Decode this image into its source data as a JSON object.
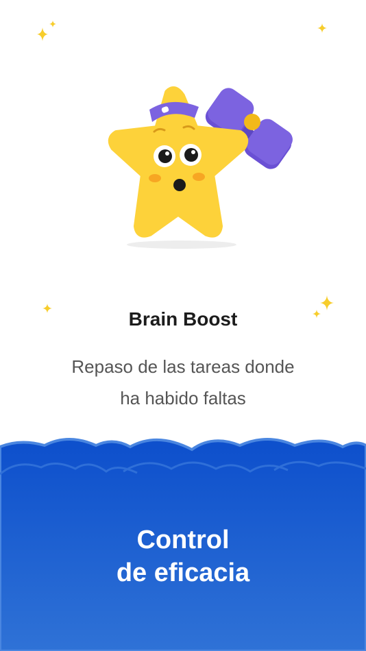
{
  "card": {
    "title": "Brain Boost",
    "description_line1": "Repaso de las tareas donde",
    "description_line2": "ha habido faltas"
  },
  "footer": {
    "title_line1": "Control",
    "title_line2": "de eficacia"
  },
  "colors": {
    "sparkle": "#f7cd2c",
    "star": "#fdd23a",
    "dumbbell": "#7c63e0",
    "footer_top": "#0d4fcc",
    "footer_bottom": "#2f72d6"
  },
  "icons": [
    "sparkle-icon",
    "star-mascot-icon",
    "dumbbell-icon",
    "cloud-edge"
  ]
}
